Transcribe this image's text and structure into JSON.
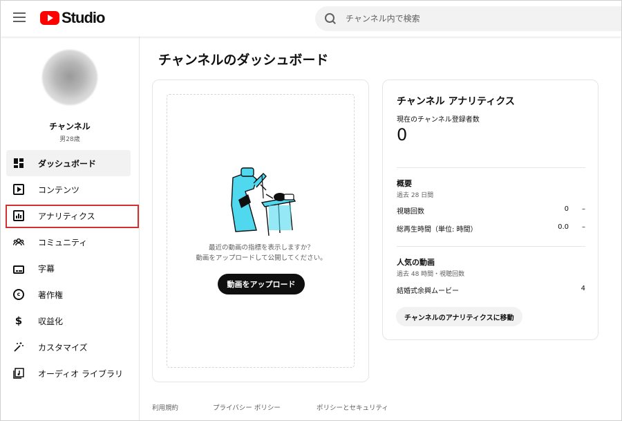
{
  "header": {
    "logo_text": "Studio",
    "search_placeholder": "チャンネル内で検索"
  },
  "sidebar": {
    "channel_name": "チャンネル",
    "channel_subtitle": "男28歳",
    "items": [
      {
        "label": "ダッシュボード",
        "icon": "dashboard-icon",
        "active": true
      },
      {
        "label": "コンテンツ",
        "icon": "content-icon"
      },
      {
        "label": "アナリティクス",
        "icon": "analytics-icon",
        "highlighted": true
      },
      {
        "label": "コミュニティ",
        "icon": "community-icon"
      },
      {
        "label": "字幕",
        "icon": "subtitles-icon"
      },
      {
        "label": "著作権",
        "icon": "copyright-icon"
      },
      {
        "label": "収益化",
        "icon": "monetization-icon"
      },
      {
        "label": "カスタマイズ",
        "icon": "customize-icon"
      },
      {
        "label": "オーディオ ライブラリ",
        "icon": "audio-library-icon"
      }
    ]
  },
  "main": {
    "title": "チャンネルのダッシュボード",
    "upload_card": {
      "message_line1": "最近の動画の指標を表示しますか？",
      "message_line2": "動画をアップロードして公開してください。",
      "button_label": "動画をアップロード"
    },
    "analytics_card": {
      "title": "チャンネル アナリティクス",
      "subscribers_label": "現在のチャンネル登録者数",
      "subscribers_value": "0",
      "summary_title": "概要",
      "summary_period": "過去 28 日間",
      "summary_rows": [
        {
          "label": "視聴回数",
          "value": "0",
          "trend": "–"
        },
        {
          "label": "総再生時間（単位: 時間）",
          "value": "0.0",
          "trend": "–"
        }
      ],
      "top_videos_title": "人気の動画",
      "top_videos_period": "過去 48 時間・視聴回数",
      "top_videos": [
        {
          "title": "結婚式余興ムービー",
          "views": "4"
        }
      ],
      "go_button_label": "チャンネルのアナリティクスに移動"
    }
  },
  "footer": {
    "links": [
      "利用規約",
      "プライバシー ポリシー",
      "ポリシーとセキュリティ"
    ]
  },
  "colors": {
    "brand_red": "#ff0000",
    "highlight_border": "#d32f2f",
    "illustration_cyan": "#4fd8ee"
  }
}
